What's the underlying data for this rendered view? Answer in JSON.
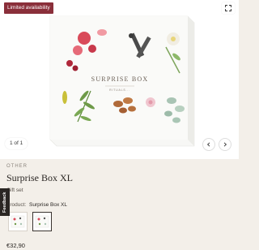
{
  "badge": "Limited availability",
  "gallery": {
    "counter": "1 of 1"
  },
  "product": {
    "box_title": "SURPRISE BOX",
    "box_brand": "RITUALS...",
    "category": "OTHER",
    "title": "Surprise Box XL",
    "subtitle": "Gift set",
    "variant_label": "Product:",
    "variant_value": "Surprise Box XL",
    "price": "€32,90"
  },
  "feedback_tab": "Feedback",
  "colors": {
    "badge": "#8a2f3a",
    "background": "#f3efe9"
  }
}
